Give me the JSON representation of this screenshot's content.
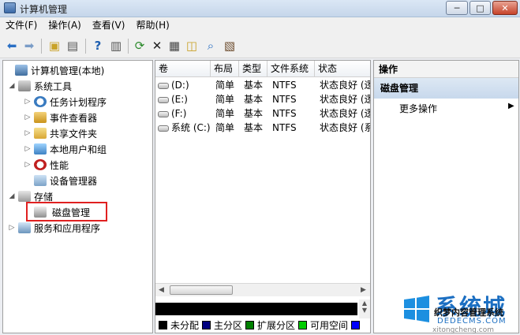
{
  "window": {
    "title": "计算机管理",
    "controls": {
      "minimize": "─",
      "maximize": "□",
      "close": "✕"
    }
  },
  "menubar": {
    "items": [
      "文件(F)",
      "操作(A)",
      "查看(V)",
      "帮助(H)"
    ]
  },
  "toolbar": {
    "icons": [
      "back-icon",
      "forward-icon",
      "up-folder-icon",
      "show-hide-tree-icon",
      "help-icon",
      "show-hide-action-icon",
      "refresh-icon",
      "delete-icon",
      "properties-icon",
      "open-icon",
      "search-icon",
      "export-icon"
    ]
  },
  "tree": {
    "items": [
      {
        "label": "计算机管理(本地)",
        "icon": "computer-icon"
      },
      {
        "label": "系统工具",
        "icon": "tools-icon"
      },
      {
        "label": "任务计划程序",
        "icon": "clock-icon"
      },
      {
        "label": "事件查看器",
        "icon": "event-viewer-icon"
      },
      {
        "label": "共享文件夹",
        "icon": "shared-folder-icon"
      },
      {
        "label": "本地用户和组",
        "icon": "users-icon"
      },
      {
        "label": "性能",
        "icon": "performance-icon"
      },
      {
        "label": "设备管理器",
        "icon": "device-manager-icon"
      },
      {
        "label": "存储",
        "icon": "storage-icon"
      },
      {
        "label": "磁盘管理",
        "icon": "disk-management-icon"
      },
      {
        "label": "服务和应用程序",
        "icon": "services-icon"
      }
    ],
    "selected": "磁盘管理"
  },
  "volumes": {
    "columns": [
      "卷",
      "布局",
      "类型",
      "文件系统",
      "状态"
    ],
    "rows": [
      [
        "(D:)",
        "简单",
        "基本",
        "NTFS",
        "状态良好 (逻"
      ],
      [
        "(E:)",
        "简单",
        "基本",
        "NTFS",
        "状态良好 (逻"
      ],
      [
        "(F:)",
        "简单",
        "基本",
        "NTFS",
        "状态良好 (逻"
      ],
      [
        "系统 (C:)",
        "简单",
        "基本",
        "NTFS",
        "状态良好 (系"
      ]
    ]
  },
  "legend": {
    "items": [
      {
        "label": "未分配",
        "color": "#000000"
      },
      {
        "label": "主分区",
        "color": "#000080"
      },
      {
        "label": "扩展分区",
        "color": "#008000"
      },
      {
        "label": "可用空间",
        "color": "#00cc00"
      },
      {
        "label": "",
        "color": "#0000ff"
      }
    ]
  },
  "actions": {
    "header": "操作",
    "section": "磁盘管理",
    "more": "更多操作",
    "more_arrow": "▶"
  },
  "watermark": {
    "brand": "系统城",
    "line1": "织梦内容管理系统",
    "line2": "DEDECMS.COM",
    "line3": "xitongcheng.com"
  },
  "colors": {
    "titlebar": "#c6d6ea",
    "highlight_box": "#e02020",
    "actions_section": "#c7d8ec",
    "watermark_blue": "#1c6fc2"
  }
}
